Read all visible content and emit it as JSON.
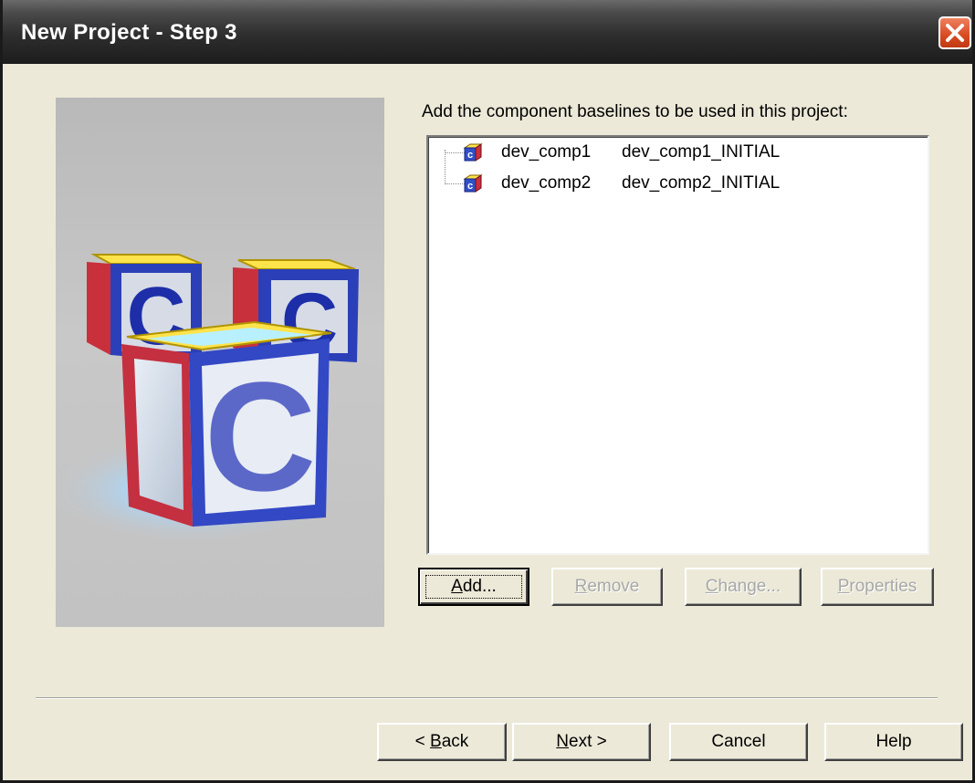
{
  "window": {
    "title": "New Project - Step 3"
  },
  "prompt": "Add the component baselines to be used in this project:",
  "components": [
    {
      "name": "dev_comp1",
      "baseline": "dev_comp1_INITIAL",
      "icon": "component-icon"
    },
    {
      "name": "dev_comp2",
      "baseline": "dev_comp2_INITIAL",
      "icon": "component-icon"
    }
  ],
  "action_buttons": {
    "add": {
      "pre": "",
      "key": "A",
      "post": "dd...",
      "enabled": true
    },
    "remove": {
      "pre": "",
      "key": "R",
      "post": "emove",
      "enabled": false
    },
    "change": {
      "pre": "",
      "key": "C",
      "post": "hange...",
      "enabled": false
    },
    "properties": {
      "pre": "",
      "key": "P",
      "post": "roperties",
      "enabled": false
    }
  },
  "nav_buttons": {
    "back": {
      "pre": "< ",
      "key": "B",
      "post": "ack"
    },
    "next": {
      "pre": "",
      "key": "N",
      "post": "ext >"
    },
    "cancel": {
      "label": "Cancel"
    },
    "help": {
      "label": "Help"
    }
  },
  "illustration": {
    "letter": "C",
    "icon": "clearcase-blocks-illustration"
  }
}
